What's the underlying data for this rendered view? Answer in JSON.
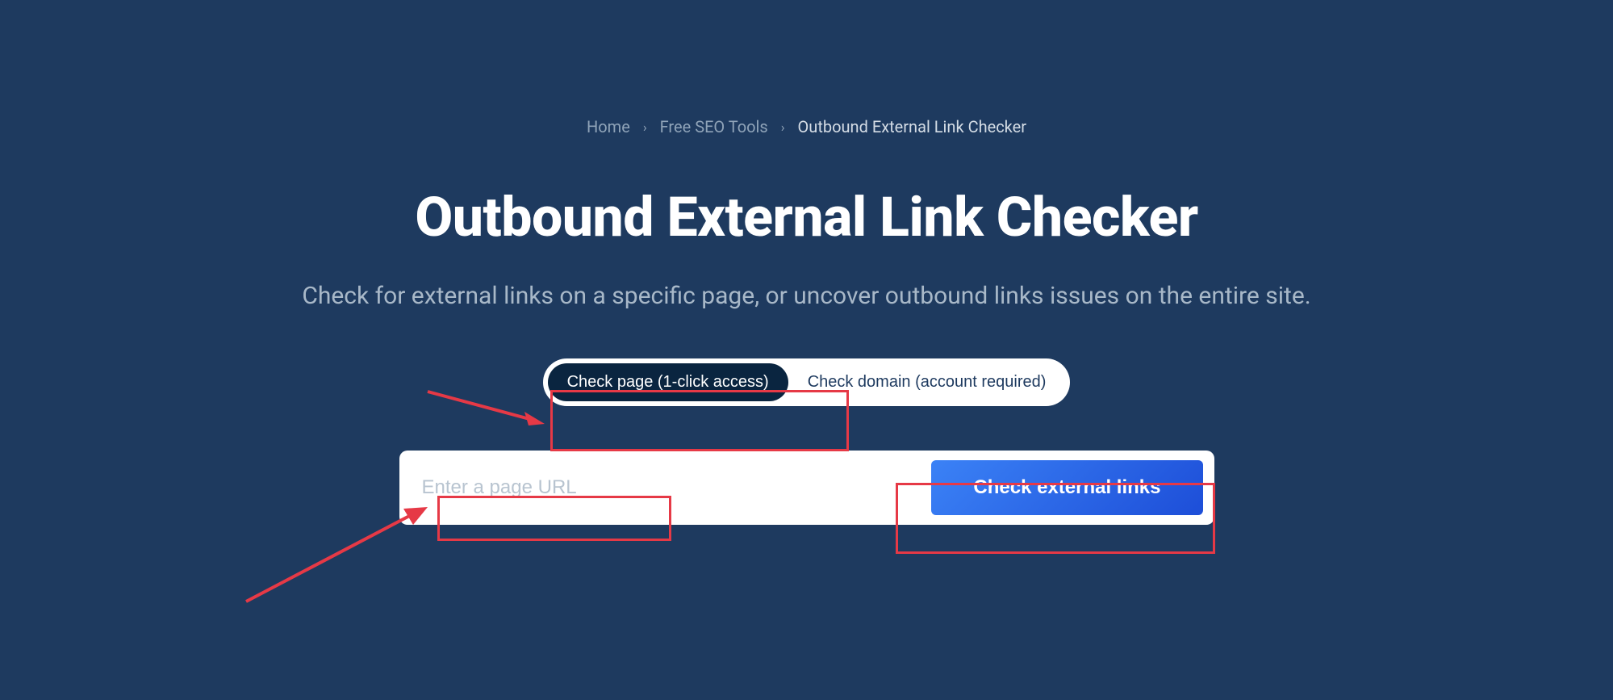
{
  "breadcrumb": {
    "home": "Home",
    "tools": "Free SEO Tools",
    "current": "Outbound External Link Checker",
    "separator": "›"
  },
  "title": "Outbound External Link Checker",
  "subtitle": "Check for external links on a specific page, or uncover outbound links issues on the entire site.",
  "tabs": {
    "check_page": "Check page (1-click access)",
    "check_domain": "Check domain (account required)"
  },
  "search": {
    "placeholder": "Enter a page URL",
    "button_label": "Check external links"
  },
  "annotations": {
    "arrow_color": "#e63946",
    "box_color": "#e63946"
  }
}
